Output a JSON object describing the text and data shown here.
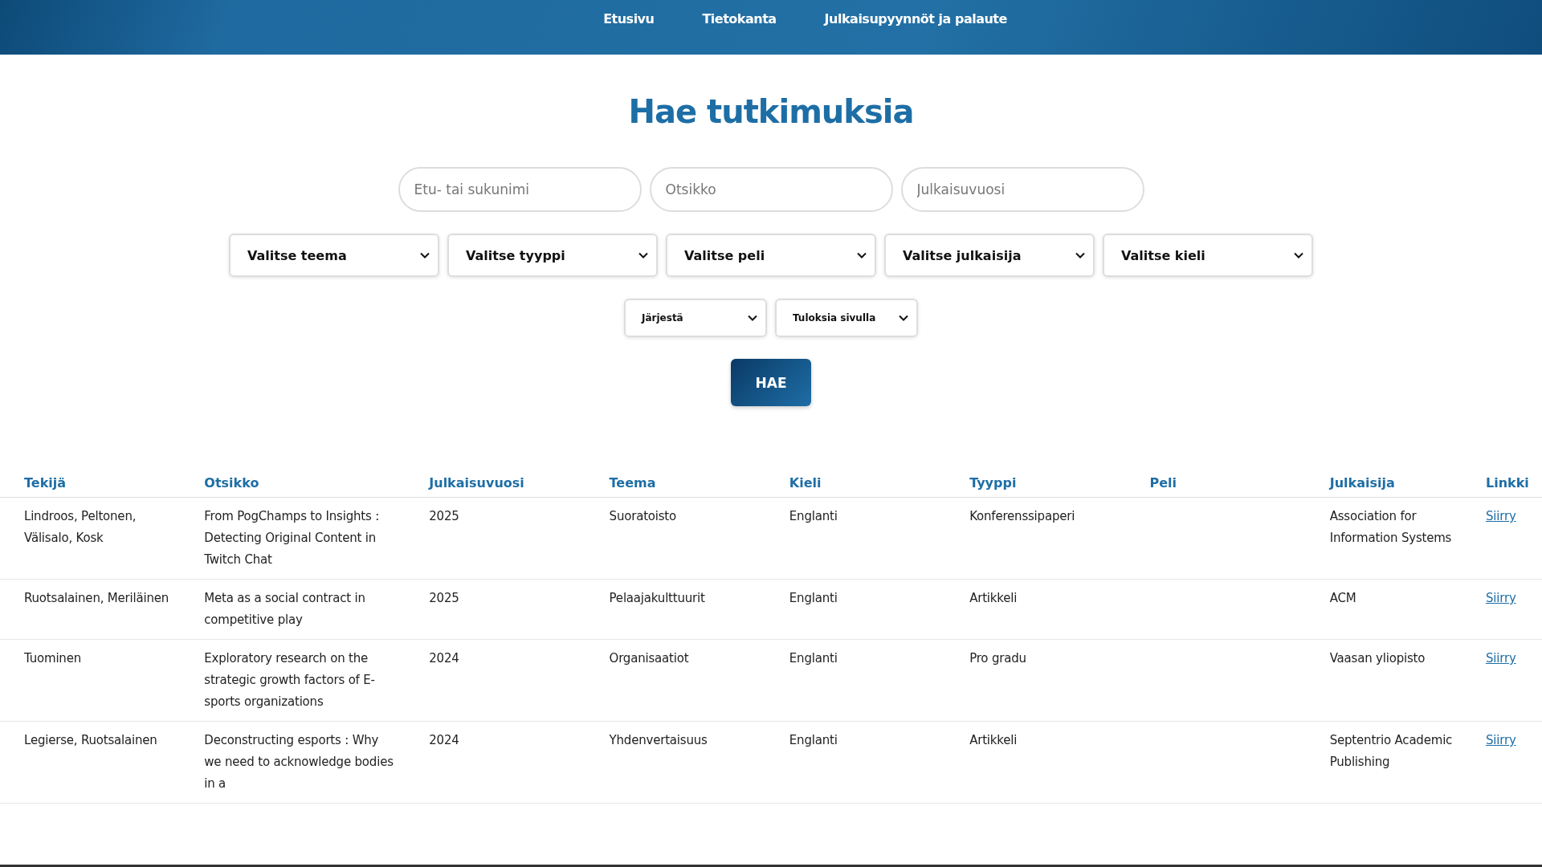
{
  "nav": {
    "links": [
      {
        "label": "Etusivu"
      },
      {
        "label": "Tietokanta"
      },
      {
        "label": "Julkaisupyynnöt ja palaute"
      }
    ]
  },
  "title": "Hae tutkimuksia",
  "search_fields": [
    {
      "placeholder": "Etu- tai sukunimi"
    },
    {
      "placeholder": "Otsikko"
    },
    {
      "placeholder": "Julkaisuvuosi"
    }
  ],
  "filters": [
    {
      "label": "Valitse teema"
    },
    {
      "label": "Valitse tyyppi"
    },
    {
      "label": "Valitse peli"
    },
    {
      "label": "Valitse julkaisija"
    },
    {
      "label": "Valitse kieli"
    }
  ],
  "options": [
    {
      "label": "Järjestä"
    },
    {
      "label": "Tuloksia sivulla"
    }
  ],
  "search_button": "HAE",
  "table": {
    "columns": [
      "Tekijä",
      "Otsikko",
      "Julkaisuvuosi",
      "Teema",
      "Kieli",
      "Tyyppi",
      "Peli",
      "Julkaisija",
      "Linkki"
    ],
    "rows": [
      {
        "author": "Lindroos, Peltonen, Välisalo, Kosk",
        "title": "From PogChamps to Insights : Detecting Original Content in Twitch Chat",
        "year": "2025",
        "theme": "Suoratoisto",
        "language": "Englanti",
        "type": "Konferenssipaperi",
        "game": "",
        "publisher": "Association for Information Systems",
        "link": "Siirry"
      },
      {
        "author": "Ruotsalainen, Meriläinen",
        "title": "Meta as a social contract in competitive play",
        "year": "2025",
        "theme": "Pelaajakulttuurit",
        "language": "Englanti",
        "type": "Artikkeli",
        "game": "",
        "publisher": "ACM",
        "link": "Siirry"
      },
      {
        "author": "Tuominen",
        "title": "Exploratory research on the strategic growth factors of E-sports organizations",
        "year": "2024",
        "theme": "Organisaatiot",
        "language": "Englanti",
        "type": "Pro gradu",
        "game": "",
        "publisher": "Vaasan yliopisto",
        "link": "Siirry"
      },
      {
        "author": "Legierse, Ruotsalainen",
        "title": "Deconstructing esports : Why we need to acknowledge bodies in a",
        "year": "2024",
        "theme": "Yhdenvertaisuus",
        "language": "Englanti",
        "type": "Artikkeli",
        "game": "",
        "publisher": "Septentrio Academic Publishing",
        "link": "Siirry"
      }
    ]
  }
}
